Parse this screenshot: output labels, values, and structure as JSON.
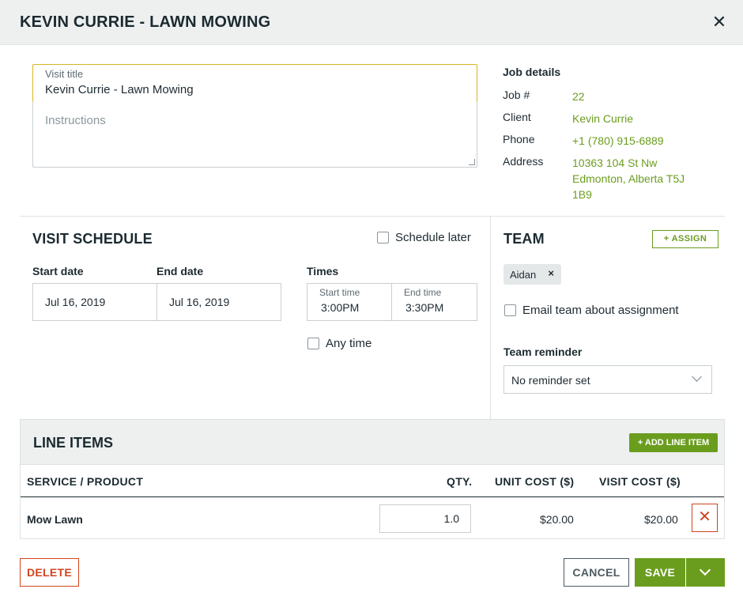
{
  "dialog": {
    "title": "KEVIN CURRIE - LAWN MOWING",
    "close_icon": "close-icon"
  },
  "visit": {
    "title_label": "Visit title",
    "title_value": "Kevin Currie - Lawn Mowing",
    "instructions_placeholder": "Instructions"
  },
  "job_details": {
    "heading": "Job details",
    "rows": [
      {
        "key": "Job #",
        "value": "22"
      },
      {
        "key": "Client",
        "value": "Kevin Currie"
      },
      {
        "key": "Phone",
        "value": "+1 (780) 915-6889"
      },
      {
        "key": "Address",
        "value": "10363 104 St Nw"
      }
    ],
    "address_line2": "Edmonton, Alberta T5J",
    "address_line3": "1B9"
  },
  "schedule": {
    "title": "VISIT SCHEDULE",
    "schedule_later": "Schedule later",
    "start_label": "Start date",
    "end_label": "End date",
    "start_date": "Jul 16, 2019",
    "end_date": "Jul 16, 2019",
    "times_label": "Times",
    "start_time_label": "Start time",
    "start_time": "3:00PM",
    "end_time_label": "End time",
    "end_time": "3:30PM",
    "any_time": "Any time"
  },
  "team": {
    "title": "TEAM",
    "assign_label": "+   ASSIGN",
    "member": "Aidan",
    "email_label": "Email team about assignment",
    "reminder_label": "Team reminder",
    "reminder_value": "No reminder set"
  },
  "line_items": {
    "title": "LINE ITEMS",
    "add_label": "+ ADD LINE ITEM",
    "columns": [
      "SERVICE / PRODUCT",
      "QTY.",
      "UNIT COST ($)",
      "VISIT COST ($)"
    ],
    "rows": [
      {
        "name": "Mow Lawn",
        "qty": "1.0",
        "unit_cost": "$20.00",
        "visit_cost": "$20.00"
      }
    ]
  },
  "footer": {
    "delete_label": "DELETE",
    "cancel_label": "CANCEL",
    "save_label": "SAVE"
  },
  "colors": {
    "accent": "#6a9d1e",
    "danger": "#d2441e",
    "focus": "#d7b523"
  }
}
